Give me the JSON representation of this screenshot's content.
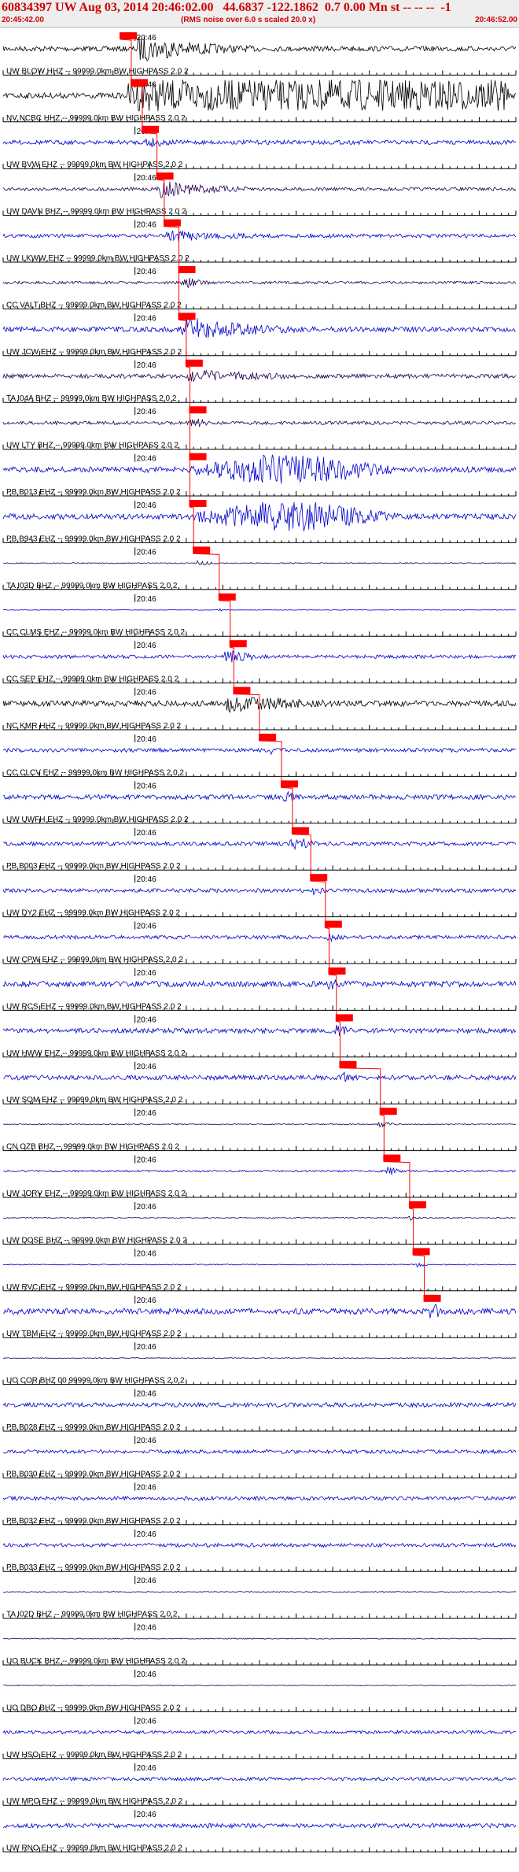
{
  "header": {
    "title": "60834397 UW Aug 03, 2014 20:46:02.00   44.6837 -122.1862  0.7 0.00 Mn st -- -- --  -1",
    "start_time": "20:45:42.00",
    "end_time": "20:46:52.00",
    "noise_note": "(RMS noise over 6.0 s scaled 20.0 x)"
  },
  "minute_label": "20:46",
  "colors": {
    "title": "#d00000",
    "axis": "#000000",
    "pick": "#ff0000",
    "trace_black": "#000000",
    "trace_blue": "#0000cc",
    "trace_navy": "#220055"
  },
  "traces": [
    {
      "label": "UW BLOW HHZ -- 99999.0km BW  HIGHPASS  2.0  2",
      "color": "black",
      "pick_s": 16.0,
      "amp": 0.9,
      "event_s": 18,
      "dur_s": 30,
      "style": "event"
    },
    {
      "label": "NV NCBC HHZ -- 99999.0km BW  HIGHPASS  2.0  2",
      "color": "black",
      "pick_s": 17.5,
      "amp": 1.0,
      "event_s": 17,
      "dur_s": 52,
      "style": "saturated"
    },
    {
      "label": "UW BVW EHZ -- 99999.0km BW  HIGHPASS  2.0  2",
      "color": "blue",
      "pick_s": 19.0,
      "amp": 0.45,
      "event_s": 19,
      "dur_s": 12,
      "style": "noisy"
    },
    {
      "label": "UW DAVN BHZ -- 99999.0km BW  HIGHPASS  2.0  2",
      "color": "navy",
      "pick_s": 21.0,
      "amp": 0.6,
      "event_s": 21,
      "dur_s": 25,
      "style": "event"
    },
    {
      "label": "UW LKWW EHZ -- 99999.0km BW  HIGHPASS  2.0  2",
      "color": "blue",
      "pick_s": 22.0,
      "amp": 0.4,
      "event_s": 22,
      "dur_s": 35,
      "style": "noisy"
    },
    {
      "label": "CC VALT BHZ -- 99999.0km BW  HIGHPASS  2.0  2",
      "color": "navy",
      "pick_s": 24.0,
      "amp": 0.5,
      "event_s": 24,
      "dur_s": 8,
      "style": "event"
    },
    {
      "label": "UW JCW EHZ -- 99999.0km BW  HIGHPASS  2.0  2",
      "color": "blue",
      "pick_s": 24.0,
      "amp": 0.9,
      "event_s": 24,
      "dur_s": 30,
      "style": "event"
    },
    {
      "label": "TA I04A BHZ -- 99999.0km BW  HIGHPASS  2.0  2",
      "color": "navy",
      "pick_s": 25.0,
      "amp": 0.45,
      "event_s": 25,
      "dur_s": 40,
      "style": "noisy"
    },
    {
      "label": "UW LTY BHZ -- 99999.0km BW  HIGHPASS  2.0  2",
      "color": "navy",
      "pick_s": 25.5,
      "amp": 0.6,
      "event_s": 25,
      "dur_s": 6,
      "style": "event"
    },
    {
      "label": "PB B013 EHZ -- 99999.0km BW  HIGHPASS  2.0  2",
      "color": "blue",
      "pick_s": 25.5,
      "amp": 1.0,
      "event_s": 25,
      "dur_s": 40,
      "style": "spindle"
    },
    {
      "label": "PB B943 EHZ -- 99999.0km BW  HIGHPASS  2.0  2",
      "color": "blue",
      "pick_s": 25.5,
      "amp": 1.0,
      "event_s": 25,
      "dur_s": 40,
      "style": "spindle"
    },
    {
      "label": "TA I03D BHZ -- 99999.0km BW  HIGHPASS  2.0  2",
      "color": "navy",
      "pick_s": 26.0,
      "amp": 0.3,
      "event_s": 26,
      "dur_s": 5,
      "style": "quiet"
    },
    {
      "label": "CC CLMS EHZ -- 99999.0km BW  HIGHPASS  2.0  2",
      "color": "blue",
      "pick_s": 29.5,
      "amp": 0.15,
      "event_s": 29,
      "dur_s": 3,
      "style": "quiet"
    },
    {
      "label": "CC SEP EHZ -- 99999.0km BW  HIGHPASS  2.0  2",
      "color": "blue",
      "pick_s": 31.0,
      "amp": 0.6,
      "event_s": 30,
      "dur_s": 10,
      "style": "event"
    },
    {
      "label": "NC KMR HHZ -- 99999.0km BW  HIGHPASS  2.0  2",
      "color": "black",
      "pick_s": 31.5,
      "amp": 0.6,
      "event_s": 30,
      "dur_s": 40,
      "style": "noisy"
    },
    {
      "label": "CC CLCV EHZ -- 99999.0km BW  HIGHPASS  2.0  2",
      "color": "blue",
      "pick_s": 35.0,
      "amp": 0.4,
      "event_s": 36,
      "dur_s": 6,
      "style": "noisy"
    },
    {
      "label": "UW UWFH EHZ -- 99999.0km BW  HIGHPASS  2.0  2",
      "color": "blue",
      "pick_s": 38.0,
      "amp": 0.5,
      "event_s": 38,
      "dur_s": 6,
      "style": "noisy"
    },
    {
      "label": "PB B003 EHZ -- 99999.0km BW  HIGHPASS  2.0  2",
      "color": "blue",
      "pick_s": 39.5,
      "amp": 0.7,
      "event_s": 39,
      "dur_s": 8,
      "style": "event"
    },
    {
      "label": "UW DY2 EHZ -- 99999.0km BW  HIGHPASS  2.0  2",
      "color": "blue",
      "pick_s": 42.0,
      "amp": 0.4,
      "event_s": 42,
      "dur_s": 6,
      "style": "noisy"
    },
    {
      "label": "UW CPW EHZ -- 99999.0km BW  HIGHPASS  2.0  2",
      "color": "blue",
      "pick_s": 44.0,
      "amp": 0.4,
      "event_s": 44,
      "dur_s": 6,
      "style": "noisy"
    },
    {
      "label": "UW RCS EHZ -- 99999.0km BW  HIGHPASS  2.0  2",
      "color": "blue",
      "pick_s": 44.5,
      "amp": 0.6,
      "event_s": 44,
      "dur_s": 8,
      "style": "noisy"
    },
    {
      "label": "UW HWW EHZ -- 99999.0km BW  HIGHPASS  2.0  2",
      "color": "blue",
      "pick_s": 45.5,
      "amp": 0.5,
      "event_s": 45,
      "dur_s": 8,
      "style": "noisy"
    },
    {
      "label": "UW SQM EHZ -- 99999.0km BW  HIGHPASS  2.0  2",
      "color": "blue",
      "pick_s": 46.0,
      "amp": 0.5,
      "event_s": 46,
      "dur_s": 6,
      "style": "noisy"
    },
    {
      "label": "CN OZB BHZ -- 99999.0km BW  HIGHPASS  2.0  2",
      "color": "navy",
      "pick_s": 51.5,
      "amp": 0.3,
      "event_s": 51,
      "dur_s": 5,
      "style": "quiet"
    },
    {
      "label": "UW JORV EHZ -- 99999.0km BW  HIGHPASS  2.0  2",
      "color": "blue",
      "pick_s": 52.0,
      "amp": 0.5,
      "event_s": 52,
      "dur_s": 4,
      "style": "quiet"
    },
    {
      "label": "UW DOSE BHZ -- 99999.0km BW  HIGHPASS  2.0  2",
      "color": "navy",
      "pick_s": 55.5,
      "amp": 0.25,
      "event_s": 55,
      "dur_s": 4,
      "style": "quiet"
    },
    {
      "label": "UW RVC EHZ -- 99999.0km BW  HIGHPASS  2.0  2",
      "color": "blue",
      "pick_s": 56.0,
      "amp": 0.25,
      "event_s": 56,
      "dur_s": 4,
      "style": "quiet"
    },
    {
      "label": "UW TBM EHZ -- 99999.0km BW  HIGHPASS  2.0  2",
      "color": "blue",
      "pick_s": 57.5,
      "amp": 1.0,
      "event_s": 58,
      "dur_s": 4,
      "style": "event"
    },
    {
      "label": "UO COR BHZ 00 99999.0km BW  HIGHPASS  2.0  2",
      "color": "navy",
      "amp": 0.25,
      "style": "quiet"
    },
    {
      "label": "PB B028 EHZ -- 99999.0km BW  HIGHPASS  2.0  2",
      "color": "blue",
      "amp": 0.45,
      "style": "noisy"
    },
    {
      "label": "PB B030 EHZ -- 99999.0km BW  HIGHPASS  2.0  2",
      "color": "blue",
      "amp": 0.4,
      "style": "noisy"
    },
    {
      "label": "PB B032 EHZ -- 99999.0km BW  HIGHPASS  2.0  2",
      "color": "blue",
      "amp": 0.4,
      "style": "noisy"
    },
    {
      "label": "PB B033 EHZ -- 99999.0km BW  HIGHPASS  2.0  2",
      "color": "blue",
      "amp": 0.4,
      "style": "noisy"
    },
    {
      "label": "TA I02D BHZ -- 99999.0km BW  HIGHPASS  2.0  2",
      "color": "navy",
      "amp": 0.25,
      "style": "quiet"
    },
    {
      "label": "UO BUCK BHZ -- 99999.0km BW  HIGHPASS  2.0  2",
      "color": "navy",
      "amp": 0.25,
      "style": "quiet"
    },
    {
      "label": "UO DBO BHZ -- 99999.0km BW  HIGHPASS  2.0  2",
      "color": "navy",
      "amp": 0.25,
      "style": "quiet"
    },
    {
      "label": "UW HSO EHZ -- 99999.0km BW  HIGHPASS  2.0  2",
      "color": "blue",
      "amp": 0.35,
      "style": "noisy"
    },
    {
      "label": "UW MPO EHZ -- 99999.0km BW  HIGHPASS  2.0  2",
      "color": "blue",
      "amp": 0.35,
      "style": "noisy"
    },
    {
      "label": "UW RNO EHZ -- 99999.0km BW  HIGHPASS  2.0  2",
      "color": "blue",
      "amp": 0.45,
      "style": "noisy"
    }
  ]
}
